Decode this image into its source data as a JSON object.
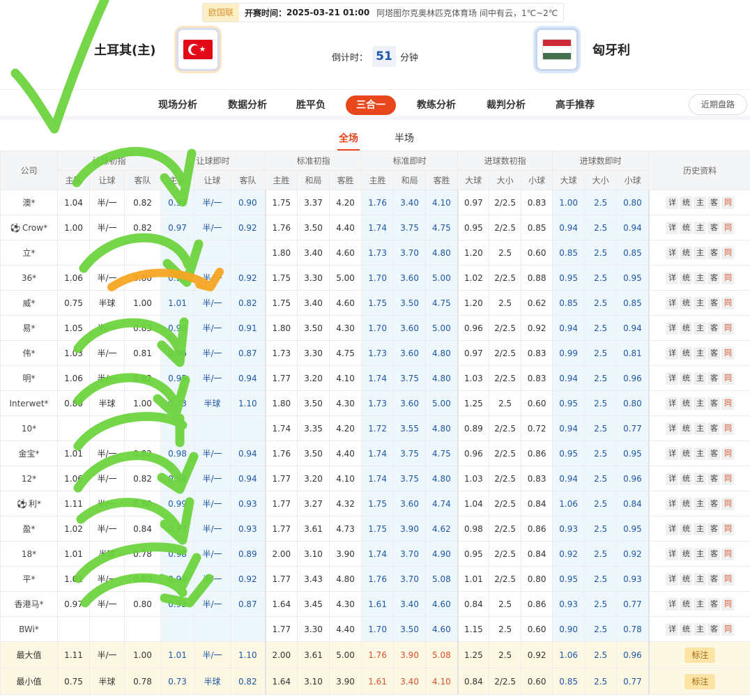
{
  "header": {
    "league": "欧国联",
    "kickoff_label": "开赛时间：",
    "kickoff_time": "2025-03-21 01:00",
    "venue_weather": "阿塔图尔克奥林匹克体育场  间中有云，1℃~2℃",
    "home_team": "土耳其(主)",
    "away_team": "匈牙利",
    "countdown_label": "倒计时：",
    "countdown_value": "51",
    "countdown_unit": "分钟"
  },
  "flags": {
    "hungary_colors": [
      "#ce2939",
      "#ffffff",
      "#477050"
    ],
    "turkey_color": "#e30a17"
  },
  "nav": {
    "items": [
      "现场分析",
      "数据分析",
      "胜平负",
      "三合一",
      "教练分析",
      "裁判分析",
      "高手推荐"
    ],
    "active": "三合一",
    "recent_button": "近期盘路"
  },
  "subtabs": {
    "full": "全场",
    "half": "半场",
    "active": "全场"
  },
  "colors": {
    "accent": "#e8471c",
    "blue": "#1e56a8",
    "live_bg": "#eef7fb",
    "summary_bg": "#fdf8e3"
  },
  "table": {
    "company_header": "公司",
    "group_headers": [
      "让球初指",
      "让球即时",
      "标准初指",
      "标准即时",
      "进球数初指",
      "进球数即时"
    ],
    "history_header": "历史资料",
    "sub_headers": [
      "主队",
      "让球",
      "客队",
      "主队",
      "让球",
      "客队",
      "主胜",
      "和局",
      "客胜",
      "主胜",
      "和局",
      "客胜",
      "大球",
      "大小",
      "小球",
      "大球",
      "大小",
      "小球"
    ],
    "history_buttons": [
      "详",
      "统",
      "主",
      "客",
      "同"
    ],
    "rows": [
      {
        "company": "澳*",
        "ball": false,
        "cells": [
          "1.04",
          "半/一",
          "0.82",
          "0.97",
          "半/一",
          "0.90",
          "1.75",
          "3.37",
          "4.20",
          "1.76",
          "3.40",
          "4.10",
          "0.97",
          "2/2.5",
          "0.83",
          "1.00",
          "2.5",
          "0.80"
        ]
      },
      {
        "company": "Crow*",
        "ball": true,
        "cells": [
          "1.00",
          "半/一",
          "0.82",
          "0.97",
          "半/一",
          "0.92",
          "1.76",
          "3.50",
          "4.40",
          "1.74",
          "3.75",
          "4.75",
          "0.95",
          "2/2.5",
          "0.85",
          "0.94",
          "2.5",
          "0.94"
        ]
      },
      {
        "company": "立*",
        "ball": false,
        "cells": [
          "",
          "",
          "",
          "",
          "",
          "",
          "1.80",
          "3.40",
          "4.60",
          "1.73",
          "3.70",
          "4.80",
          "1.20",
          "2.5",
          "0.60",
          "0.85",
          "2.5",
          "0.85"
        ]
      },
      {
        "company": "36*",
        "ball": false,
        "cells": [
          "1.06",
          "半/一",
          "0.80",
          "0.99",
          "半/一",
          "0.92",
          "1.75",
          "3.30",
          "5.00",
          "1.70",
          "3.60",
          "5.00",
          "1.02",
          "2/2.5",
          "0.88",
          "0.95",
          "2.5",
          "0.95"
        ]
      },
      {
        "company": "威*",
        "ball": false,
        "cells": [
          "0.75",
          "半球",
          "1.00",
          "1.01",
          "半/一",
          "0.82",
          "1.75",
          "3.40",
          "4.60",
          "1.75",
          "3.50",
          "4.75",
          "1.20",
          "2.5",
          "0.62",
          "0.85",
          "2.5",
          "0.85"
        ]
      },
      {
        "company": "易*",
        "ball": false,
        "cells": [
          "1.05",
          "半/一",
          "0.83",
          "0.98",
          "半/一",
          "0.91",
          "1.80",
          "3.50",
          "4.30",
          "1.70",
          "3.60",
          "5.00",
          "0.96",
          "2/2.5",
          "0.92",
          "0.94",
          "2.5",
          "0.94"
        ]
      },
      {
        "company": "伟*",
        "ball": false,
        "cells": [
          "1.03",
          "半/一",
          "0.81",
          "0.96",
          "半/一",
          "0.87",
          "1.73",
          "3.30",
          "4.75",
          "1.73",
          "3.60",
          "4.80",
          "0.97",
          "2/2.5",
          "0.83",
          "0.99",
          "2.5",
          "0.81"
        ]
      },
      {
        "company": "明*",
        "ball": false,
        "cells": [
          "1.06",
          "半/一",
          "0.82",
          "0.95",
          "半/一",
          "0.94",
          "1.77",
          "3.20",
          "4.10",
          "1.74",
          "3.75",
          "4.80",
          "1.03",
          "2/2.5",
          "0.83",
          "0.94",
          "2.5",
          "0.96"
        ]
      },
      {
        "company": "Interwet*",
        "ball": false,
        "cells": [
          "0.80",
          "半球",
          "1.00",
          "0.73",
          "半球",
          "1.10",
          "1.80",
          "3.50",
          "4.30",
          "1.73",
          "3.60",
          "5.00",
          "1.25",
          "2.5",
          "0.60",
          "0.95",
          "2.5",
          "0.80"
        ]
      },
      {
        "company": "10*",
        "ball": false,
        "cells": [
          "",
          "",
          "",
          "",
          "",
          "",
          "1.74",
          "3.35",
          "4.20",
          "1.72",
          "3.55",
          "4.80",
          "0.89",
          "2/2.5",
          "0.72",
          "0.94",
          "2.5",
          "0.77"
        ]
      },
      {
        "company": "金宝*",
        "ball": false,
        "cells": [
          "1.01",
          "半/一",
          "0.82",
          "0.98",
          "半/一",
          "0.94",
          "1.76",
          "3.50",
          "4.40",
          "1.74",
          "3.75",
          "4.75",
          "0.96",
          "2/2.5",
          "0.86",
          "0.95",
          "2.5",
          "0.95"
        ]
      },
      {
        "company": "12*",
        "ball": false,
        "cells": [
          "1.06",
          "半/一",
          "0.82",
          "0.98",
          "半/一",
          "0.94",
          "1.77",
          "3.20",
          "4.10",
          "1.74",
          "3.75",
          "4.80",
          "1.03",
          "2/2.5",
          "0.83",
          "0.94",
          "2.5",
          "0.96"
        ]
      },
      {
        "company": "利*",
        "ball": true,
        "cells": [
          "1.11",
          "半/一",
          "0.80",
          "0.99",
          "半/一",
          "0.93",
          "1.77",
          "3.27",
          "4.32",
          "1.75",
          "3.60",
          "4.74",
          "1.04",
          "2/2.5",
          "0.84",
          "1.06",
          "2.5",
          "0.84"
        ]
      },
      {
        "company": "盈*",
        "ball": false,
        "cells": [
          "1.02",
          "半/一",
          "0.84",
          "0.97",
          "半/一",
          "0.93",
          "1.77",
          "3.61",
          "4.73",
          "1.75",
          "3.90",
          "4.62",
          "0.98",
          "2/2.5",
          "0.86",
          "0.93",
          "2.5",
          "0.95"
        ]
      },
      {
        "company": "18*",
        "ball": false,
        "cells": [
          "1.01",
          "半球",
          "0.78",
          "0.98",
          "半/一",
          "0.89",
          "2.00",
          "3.10",
          "3.90",
          "1.74",
          "3.70",
          "4.90",
          "0.95",
          "2/2.5",
          "0.84",
          "0.92",
          "2.5",
          "0.92"
        ]
      },
      {
        "company": "平*",
        "ball": false,
        "cells": [
          "1.01",
          "半/一",
          "0.80",
          "0.99",
          "半/一",
          "0.92",
          "1.77",
          "3.43",
          "4.80",
          "1.76",
          "3.70",
          "5.08",
          "1.01",
          "2/2.5",
          "0.80",
          "0.95",
          "2.5",
          "0.93"
        ]
      },
      {
        "company": "香港马*",
        "ball": false,
        "cells": [
          "0.97",
          "半/一",
          "0.80",
          "0.93",
          "半/一",
          "0.87",
          "1.64",
          "3.45",
          "4.30",
          "1.61",
          "3.40",
          "4.60",
          "0.84",
          "2.5",
          "0.86",
          "0.93",
          "2.5",
          "0.77"
        ]
      },
      {
        "company": "BWi*",
        "ball": false,
        "cells": [
          "",
          "",
          "",
          "",
          "",
          "",
          "1.77",
          "3.30",
          "4.40",
          "1.70",
          "3.50",
          "4.60",
          "1.15",
          "2.5",
          "0.60",
          "0.90",
          "2.5",
          "0.78"
        ]
      }
    ],
    "summary": [
      {
        "label": "最大值",
        "cells": [
          "1.11",
          "半/一",
          "1.00",
          "1.01",
          "半/一",
          "1.10",
          "2.00",
          "3.61",
          "5.00",
          "1.76",
          "3.90",
          "5.08",
          "1.25",
          "2.5",
          "0.92",
          "1.06",
          "2.5",
          "0.96"
        ],
        "button": "标注"
      },
      {
        "label": "最小值",
        "cells": [
          "0.75",
          "半球",
          "0.78",
          "0.73",
          "半球",
          "0.82",
          "1.64",
          "3.10",
          "3.90",
          "1.61",
          "3.40",
          "4.10",
          "0.84",
          "2/2.5",
          "0.60",
          "0.85",
          "2.5",
          "0.77"
        ],
        "button": "标注"
      }
    ]
  }
}
